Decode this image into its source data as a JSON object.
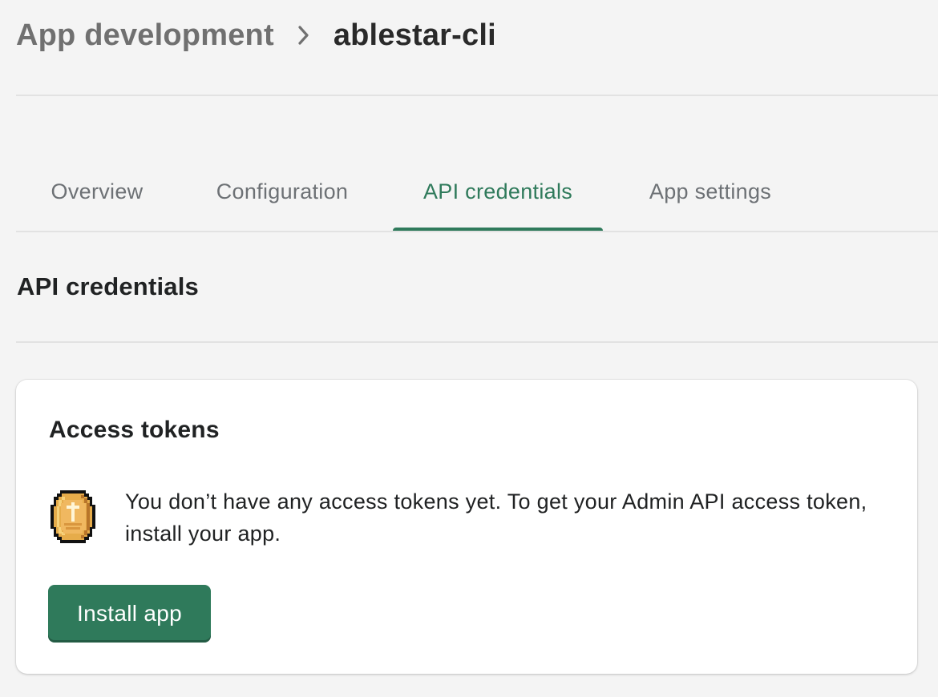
{
  "breadcrumb": {
    "parent": "App development",
    "separator_icon": "chevron-right-icon",
    "current": "ablestar-cli"
  },
  "tabs": [
    {
      "label": "Overview",
      "active": false
    },
    {
      "label": "Configuration",
      "active": false
    },
    {
      "label": "API credentials",
      "active": true
    },
    {
      "label": "App settings",
      "active": false
    }
  ],
  "section": {
    "title": "API credentials"
  },
  "access_tokens_card": {
    "title": "Access tokens",
    "icon": "gold-coin-icon",
    "empty_message": "You don’t have any access tokens yet. To get your Admin API access token, install your app.",
    "install_button_label": "Install app"
  },
  "colors": {
    "accent": "#2f7a5b",
    "page_background": "#f4f4f4",
    "card_background": "#ffffff",
    "muted_text": "#6d7175"
  }
}
